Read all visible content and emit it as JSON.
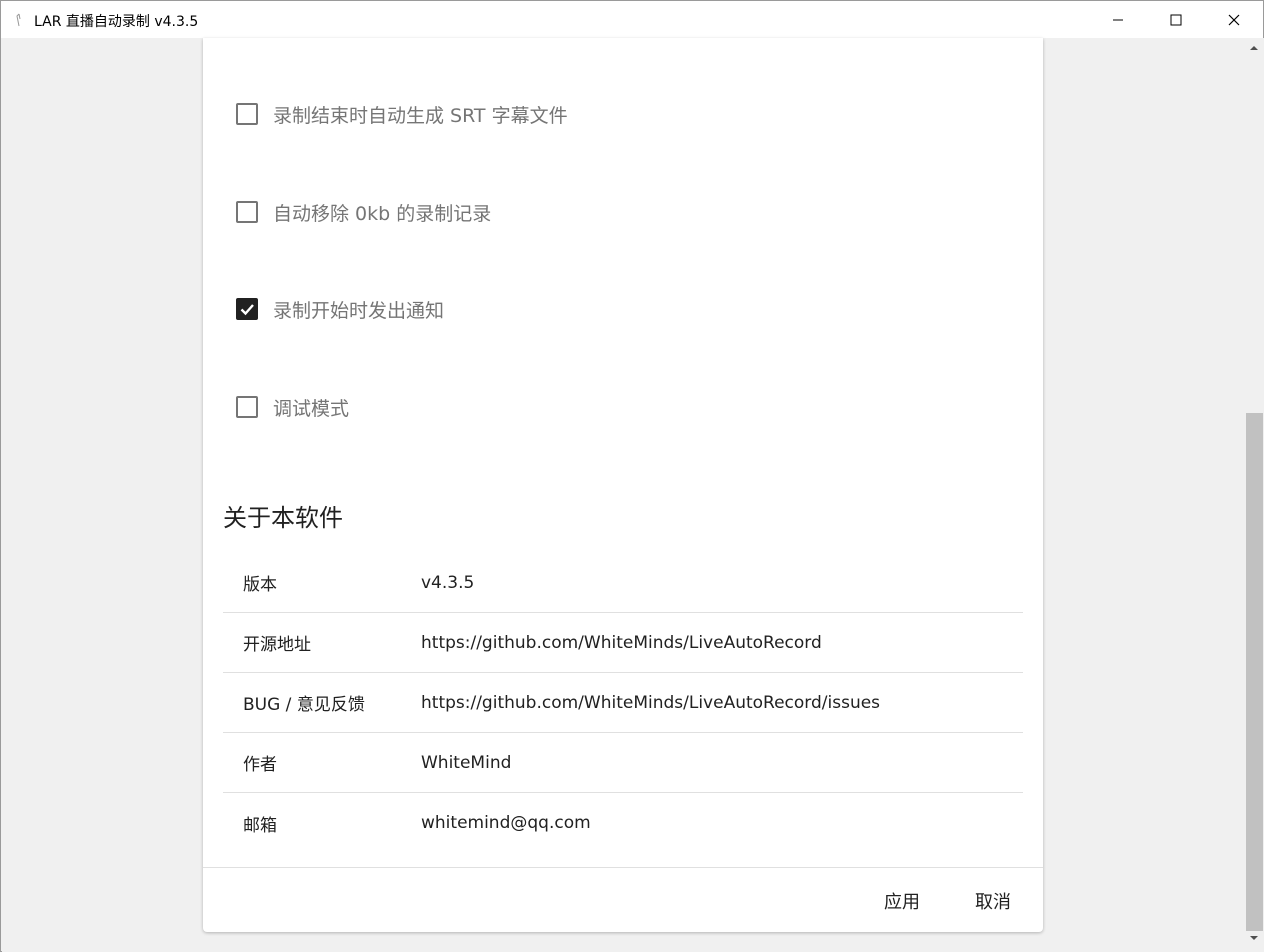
{
  "window": {
    "title": "LAR 直播自动录制 v4.3.5"
  },
  "options": [
    {
      "label": "录制结束时自动生成 SRT 字幕文件",
      "checked": false
    },
    {
      "label": "自动移除 0kb 的录制记录",
      "checked": false
    },
    {
      "label": "录制开始时发出通知",
      "checked": true
    },
    {
      "label": "调试模式",
      "checked": false
    }
  ],
  "about": {
    "title": "关于本软件",
    "rows": [
      {
        "key": "版本",
        "value": "v4.3.5"
      },
      {
        "key": "开源地址",
        "value": "https://github.com/WhiteMinds/LiveAutoRecord"
      },
      {
        "key": "BUG / 意见反馈",
        "value": "https://github.com/WhiteMinds/LiveAutoRecord/issues"
      },
      {
        "key": "作者",
        "value": "WhiteMind"
      },
      {
        "key": "邮箱",
        "value": "whitemind@qq.com"
      }
    ]
  },
  "footer": {
    "apply_label": "应用",
    "cancel_label": "取消"
  }
}
